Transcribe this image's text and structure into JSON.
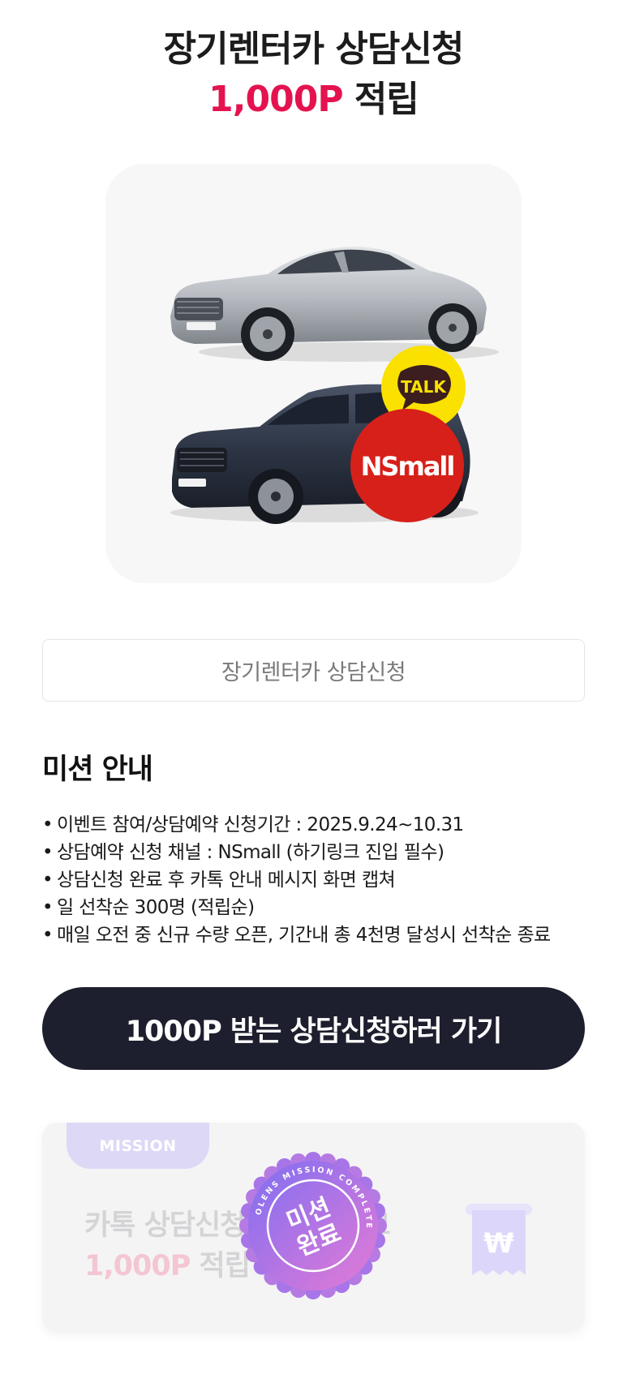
{
  "hero": {
    "title": "장기렌터카 상담신청",
    "points": "1,000P",
    "points_suffix": " 적립"
  },
  "product_image": {
    "badges": {
      "talk": "TALK",
      "nsmall": "NSmall"
    }
  },
  "consult_field": {
    "value": "장기렌터카 상담신청"
  },
  "mission_guide": {
    "title": "미션 안내",
    "rules": [
      "이벤트 참여/상담예약 신청기간 : 2025.9.24~10.31",
      "상담예약 신청 채널 : NSmall (하기링크 진입 필수)",
      "상담신청 완료 후 카톡 안내 메시지 화면 캡쳐",
      "일 선착순 300명 (적립순)",
      "매일 오전 중 신규 수량 오픈, 기간내 총 4천명 달성시 선착순 종료"
    ]
  },
  "cta": {
    "label": "1000P 받는 상담신청하러 가기"
  },
  "mission_card": {
    "tag": "MISSION",
    "line1": "카톡 상담신청 캡쳐 올리고",
    "points": "1,000P",
    "line2_suffix": " 적립",
    "receipt_symbol": "₩",
    "stamp_line1": "미션",
    "stamp_line2": "완료",
    "stamp_ring_text": "OLENS MISSION COMPLETE"
  },
  "colors": {
    "accent_pink": "#e4134f",
    "cta_dark": "#1d1f2e",
    "kakao_yellow": "#fae100",
    "nsmall_red": "#d7201a",
    "stamp_gradient_start": "#8a7bf0",
    "stamp_gradient_end": "#e07ad8"
  }
}
